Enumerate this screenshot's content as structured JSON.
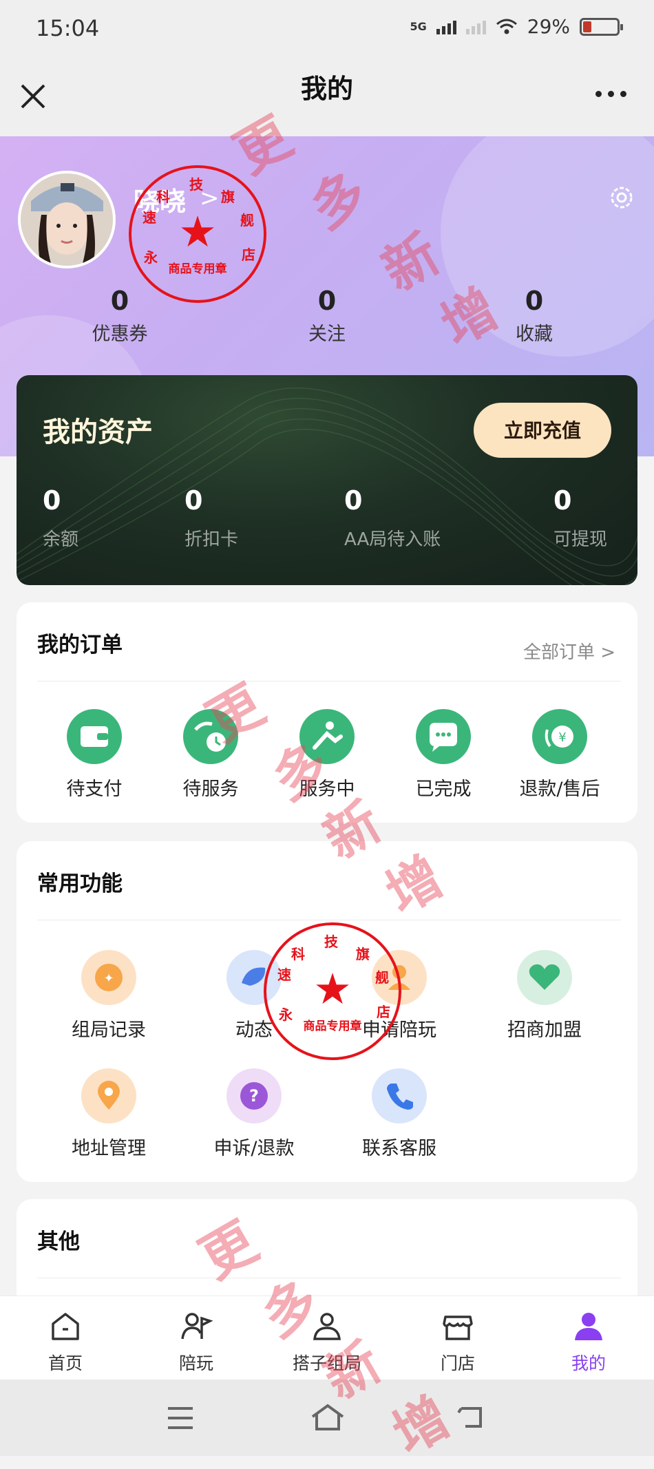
{
  "status_bar": {
    "time": "15:04",
    "network": "5G",
    "battery": "29%"
  },
  "header": {
    "title": "我的"
  },
  "profile": {
    "name": "晓晓",
    "chevron": ">"
  },
  "stats": [
    {
      "value": "0",
      "label": "优惠券"
    },
    {
      "value": "0",
      "label": "关注"
    },
    {
      "value": "0",
      "label": "收藏"
    }
  ],
  "assets": {
    "title": "我的资产",
    "recharge_label": "立即充值",
    "items": [
      {
        "value": "0",
        "label": "余额"
      },
      {
        "value": "0",
        "label": "折扣卡"
      },
      {
        "value": "0",
        "label": "AA局待入账"
      },
      {
        "value": "0",
        "label": "可提现"
      }
    ]
  },
  "orders": {
    "title": "我的订单",
    "all_label": "全部订单 >",
    "items": [
      {
        "label": "待支付",
        "icon": "wallet-icon"
      },
      {
        "label": "待服务",
        "icon": "clock-icon"
      },
      {
        "label": "服务中",
        "icon": "service-icon"
      },
      {
        "label": "已完成",
        "icon": "chat-dots-icon"
      },
      {
        "label": "退款/售后",
        "icon": "refund-icon"
      }
    ]
  },
  "functions": {
    "title": "常用功能",
    "items": [
      {
        "label": "组局记录",
        "icon": "record-icon"
      },
      {
        "label": "动态",
        "icon": "feed-icon"
      },
      {
        "label": "申请陪玩",
        "icon": "apply-icon"
      },
      {
        "label": "招商加盟",
        "icon": "handshake-icon"
      },
      {
        "label": "地址管理",
        "icon": "location-icon"
      },
      {
        "label": "申诉/退款",
        "icon": "question-icon"
      },
      {
        "label": "联系客服",
        "icon": "phone-icon"
      }
    ]
  },
  "other": {
    "title": "其他"
  },
  "tabbar": {
    "items": [
      {
        "label": "首页",
        "icon": "home-icon"
      },
      {
        "label": "陪玩",
        "icon": "companion-icon"
      },
      {
        "label": "搭子组局",
        "icon": "group-icon"
      },
      {
        "label": "门店",
        "icon": "store-icon"
      },
      {
        "label": "我的",
        "icon": "user-icon"
      }
    ],
    "active_index": 4,
    "active_color": "#8a3ff0"
  },
  "seal": {
    "ring_text": "速科技旗舰店",
    "side_text": "永",
    "bottom_text": "商品专用章"
  },
  "watermark": {
    "text": "更多新增"
  }
}
